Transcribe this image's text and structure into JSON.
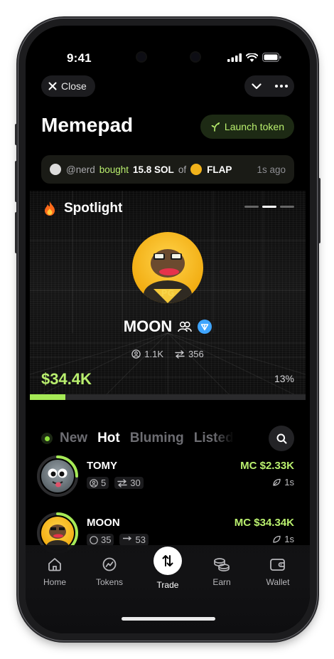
{
  "status": {
    "time": "9:41"
  },
  "header": {
    "close_label": "Close",
    "title": "Memepad",
    "launch_label": "Launch token"
  },
  "ticker": {
    "user": "@nerd",
    "action": "bought",
    "amount": "15.8 SOL",
    "of": "of",
    "token": "FLAP",
    "ago": "1s ago"
  },
  "spotlight": {
    "label": "Spotlight",
    "token_name": "MOON",
    "holders": "1.1K",
    "trades": "356",
    "market_cap": "$34.4K",
    "progress_label": "13%",
    "progress": 0.13,
    "slides_total": 3,
    "slide_active": 2
  },
  "tabs": [
    {
      "label": "New",
      "active": false
    },
    {
      "label": "Hot",
      "active": true
    },
    {
      "label": "Bluming",
      "active": false
    },
    {
      "label": "Listed",
      "active": false
    }
  ],
  "tokens": [
    {
      "name": "TOMY",
      "holders": "5",
      "trades": "30",
      "mc": "MC $2.33K",
      "age": "1s",
      "ring_progress": 0.25
    },
    {
      "name": "MOON",
      "holders": "35",
      "trades": "53",
      "mc": "MC $34.34K",
      "age": "1s",
      "ring_progress": 0.4
    }
  ],
  "nav": [
    {
      "label": "Home",
      "icon": "home-icon"
    },
    {
      "label": "Tokens",
      "icon": "tokens-icon"
    },
    {
      "label": "Trade",
      "icon": "trade-arrows-icon"
    },
    {
      "label": "Earn",
      "icon": "coins-icon"
    },
    {
      "label": "Wallet",
      "icon": "wallet-icon"
    }
  ],
  "colors": {
    "accent_green": "#b9ef6e",
    "progress_fill": "#a6ea56",
    "background": "#000000",
    "verified_blue": "#3fa5ff"
  }
}
